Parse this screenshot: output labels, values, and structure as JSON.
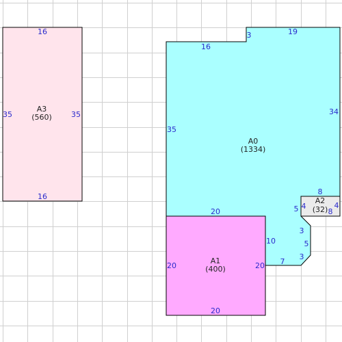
{
  "colors": {
    "background": "#ffffff",
    "grid": "#cfcfcf",
    "outline": "#000000",
    "dimension_text": "#2a2acc",
    "label_text": "#222222"
  },
  "rooms": [
    {
      "id": "A3",
      "name": "A3",
      "area": "(560)",
      "fill": "#ffe4ec",
      "dims": {
        "top": "16",
        "left": "35",
        "right": "35",
        "bottom": "16"
      }
    },
    {
      "id": "A0",
      "name": "A0",
      "area": "(1334)",
      "fill": "#aaffff",
      "dims": {
        "top_left": "16",
        "notch": "3",
        "top_right": "19",
        "right": "34",
        "left": "35",
        "bottom": "20",
        "lower_right_10": "10",
        "lower_right_7": "7",
        "a2_side": "5",
        "cut_3a": "3",
        "cut_5": "5",
        "cut_3b": "3"
      }
    },
    {
      "id": "A1",
      "name": "A1",
      "area": "(400)",
      "fill": "#ffaaff",
      "dims": {
        "left": "20",
        "right": "20",
        "bottom": "20"
      }
    },
    {
      "id": "A2",
      "name": "A2",
      "area": "(32)",
      "fill": "#ebebeb",
      "dims": {
        "top": "8",
        "left": "4",
        "right": "4",
        "bottom": "8"
      }
    }
  ]
}
